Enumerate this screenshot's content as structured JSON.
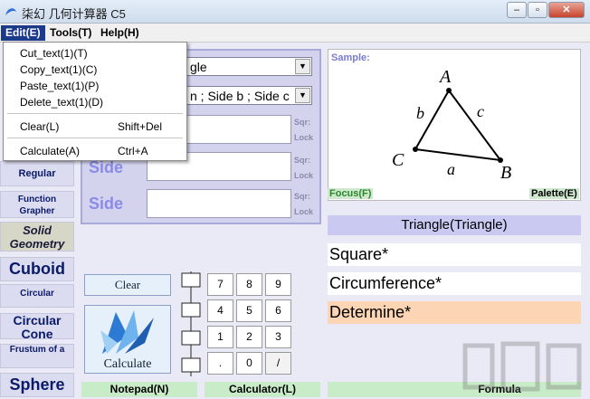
{
  "window": {
    "title": "柒幻 几何计算器 C5",
    "min_label": "–",
    "max_label": "▫",
    "close_label": "✕"
  },
  "menubar": {
    "items": [
      {
        "label": "Edit(E)"
      },
      {
        "label": "Tools(T)"
      },
      {
        "label": "Help(H)"
      }
    ]
  },
  "edit_menu": {
    "items": [
      {
        "label": "Cut_text(1)(T)",
        "shortcut": ""
      },
      {
        "label": "Copy_text(1)(C)",
        "shortcut": ""
      },
      {
        "label": "Paste_text(1)(P)",
        "shortcut": ""
      },
      {
        "label": "Delete_text(1)(D)",
        "shortcut": ""
      },
      {
        "label": "Clear(L)",
        "shortcut": "Shift+Del"
      },
      {
        "label": "Calculate(A)",
        "shortcut": "Ctrl+A"
      }
    ]
  },
  "left_panel": {
    "items": [
      {
        "label": "Regular"
      },
      {
        "label": "Function Grapher"
      },
      {
        "label": "Solid Geometry"
      },
      {
        "label": "Cuboid"
      },
      {
        "label": "Circular"
      },
      {
        "label": "Circular Cone"
      },
      {
        "label": "Frustum of a"
      },
      {
        "label": "Sphere"
      }
    ]
  },
  "input_panel": {
    "shape_select": "gle",
    "param_select": "n ; Side b ; Side c",
    "side_labels": [
      "Side",
      "Side"
    ],
    "sqr_label": "Sqr:",
    "lock_label": "Lock"
  },
  "sample": {
    "label": "Sample:",
    "vertex_a": "A",
    "vertex_b": "B",
    "vertex_c": "C",
    "side_a": "a",
    "side_b": "b",
    "side_c": "c"
  },
  "sample_footer": {
    "focus": "Focus(F)",
    "palette": "Palette(E)"
  },
  "shape_title": "Triangle(Triangle)",
  "results": [
    "Square*",
    "Circumference*",
    "Determine*"
  ],
  "buttons": {
    "clear": "Clear",
    "calculate": "Calculate"
  },
  "keypad": [
    "7",
    "8",
    "9",
    "4",
    "5",
    "6",
    "1",
    "2",
    "3",
    ".",
    "0",
    "/"
  ],
  "bottom_bar": {
    "notepad": "Notepad(N)",
    "calculator": "Calculator(L)",
    "formula": "Formula"
  }
}
